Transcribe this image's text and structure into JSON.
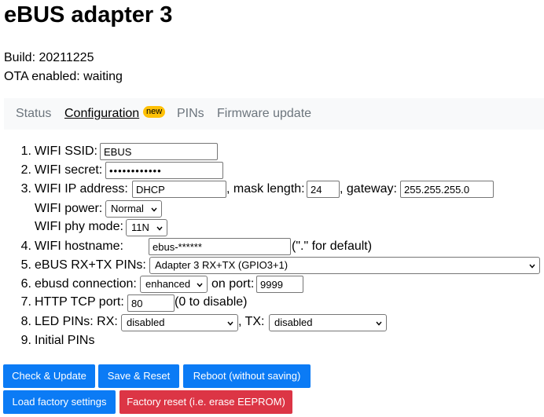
{
  "title": "eBUS adapter 3",
  "build": "Build: 20211225",
  "ota": "OTA enabled: waiting",
  "tabs": {
    "status": "Status",
    "configuration": "Configuration",
    "badge": "new",
    "pins": "PINs",
    "firmware": "Firmware update"
  },
  "form": {
    "ssid": {
      "num": "1.",
      "label": "WIFI SSID:",
      "value": "EBUS"
    },
    "secret": {
      "num": "2.",
      "label": "WIFI secret:",
      "value": "••••••••••••"
    },
    "ip": {
      "num": "3.",
      "label": "WIFI IP address:",
      "value": "DHCP",
      "mask_label": ", mask length:",
      "mask_value": "24",
      "gateway_label": ", gateway:",
      "gateway_value": "255.255.255.0"
    },
    "power": {
      "label": "WIFI power:",
      "value": "Normal"
    },
    "phy": {
      "label": "WIFI phy mode:",
      "value": "11N"
    },
    "hostname": {
      "num": "4.",
      "label": "WIFI hostname:",
      "value": "ebus-******",
      "hint": "(\".\" for default)"
    },
    "rxtx": {
      "num": "5.",
      "label": "eBUS RX+TX PINs:",
      "value": "Adapter 3 RX+TX (GPIO3+1)"
    },
    "ebusd": {
      "num": "6.",
      "label": "ebusd connection:",
      "value": "enhanced",
      "port_label": "on port:",
      "port_value": "9999"
    },
    "http": {
      "num": "7.",
      "label": "HTTP TCP port:",
      "value": "80",
      "hint": "(0 to disable)"
    },
    "led": {
      "num": "8.",
      "label": "LED PINs: RX:",
      "rx_value": "disabled",
      "tx_label": ", TX:",
      "tx_value": "disabled"
    },
    "initial": {
      "num": "9.",
      "label": "Initial PINs"
    }
  },
  "buttons": {
    "check_update": "Check & Update",
    "save_reset": "Save & Reset",
    "reboot": "Reboot (without saving)",
    "load_factory": "Load factory settings",
    "factory_reset": "Factory reset (i.e. erase EEPROM)"
  },
  "colors": {
    "primary": "#0b7bf5",
    "danger": "#dc3545",
    "badge": "#ffc107",
    "tab_bar": "#f8f9fa",
    "tab_inactive": "#6c757d"
  }
}
